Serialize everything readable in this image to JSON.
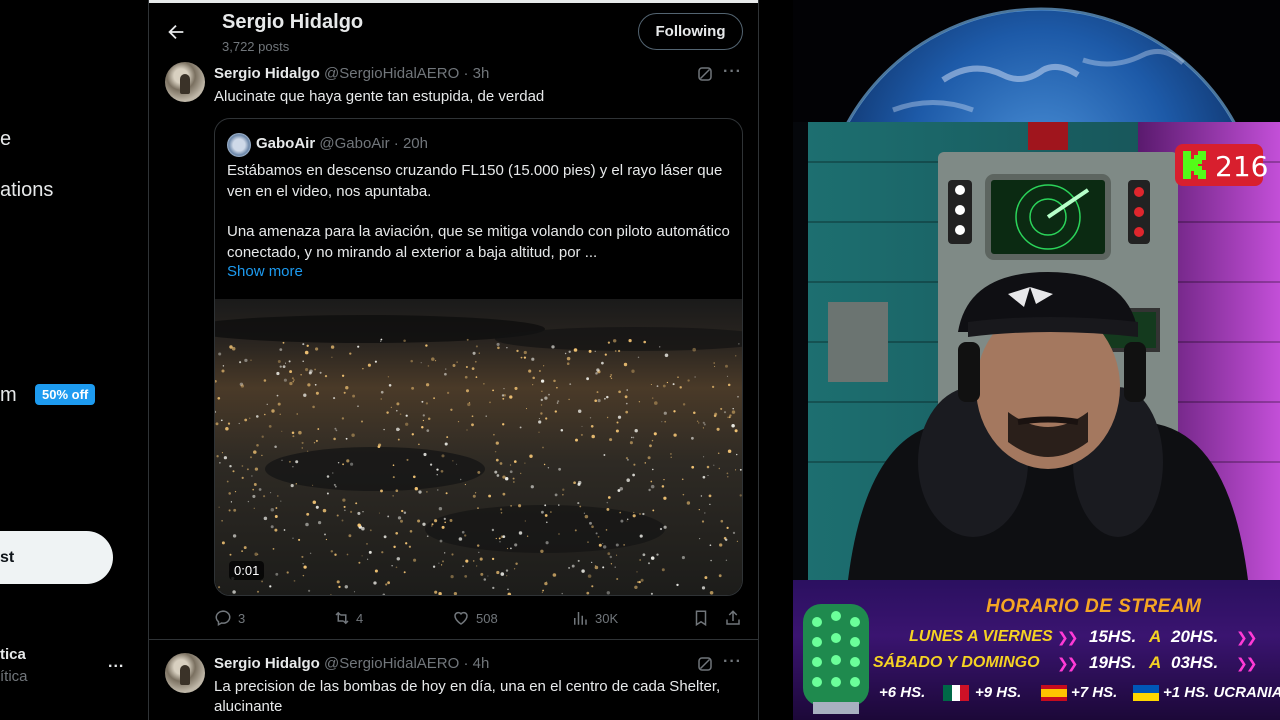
{
  "nav": {
    "partial_items": [
      {
        "text": "e"
      },
      {
        "text": "ations"
      },
      {
        "text": "m"
      }
    ],
    "premium_badge": "50% off",
    "post_button": "st",
    "account": {
      "name": "tica",
      "handle": "ítica",
      "more": "..."
    }
  },
  "header": {
    "name": "Sergio Hidalgo",
    "posts": "3,722 posts",
    "following_button": "Following"
  },
  "tweets": [
    {
      "name": "Sergio Hidalgo",
      "handle": "@SergioHidalAERO · 3h",
      "text": "Alucinate que haya gente tan estupida, de verdad",
      "quote": {
        "name": "GaboAir",
        "handle": "@GaboAir · 20h",
        "paragraph1": "Estábamos en descenso cruzando FL150 (15.000 pies) y el rayo láser que ven en el video, nos apuntaba.",
        "paragraph2": "Una amenaza para la aviación, que se mitiga volando con piloto automático conectado, y no mirando al exterior a baja altitud, por ...",
        "show_more": "Show more",
        "video_time": "0:01"
      },
      "actions": {
        "replies": "3",
        "reposts": "4",
        "likes": "508",
        "views": "30K"
      }
    },
    {
      "name": "Sergio Hidalgo",
      "handle": "@SergioHidalAERO · 4h",
      "text": "La precision de las bombas de hoy en día, una en el centro de cada Shelter, alucinante"
    }
  ],
  "stream": {
    "kick_viewers": "216",
    "schedule": {
      "title": "HORARIO DE STREAM",
      "row1_days": "LUNES A VIERNES",
      "row1_start": "15HS.",
      "row1_sep": "A",
      "row1_end": "20HS.",
      "row2_days": "SÁBADO Y DOMINGO",
      "row2_start": "19HS.",
      "row2_sep": "A",
      "row2_end": "03HS.",
      "timezones": [
        "+6 HS.",
        "+9 HS.",
        "+7 HS.",
        "+1 HS. UCRANIA"
      ]
    },
    "colors": {
      "kick_badge": "#d81f2e",
      "schedule_title": "#f5a623",
      "schedule_days": "#f5d223",
      "arrows": "#ff3ad6"
    }
  },
  "colors": {
    "accent": "#1d9bf0",
    "background": "#000000",
    "border": "#2f3336",
    "secondary_text": "#71767b"
  }
}
